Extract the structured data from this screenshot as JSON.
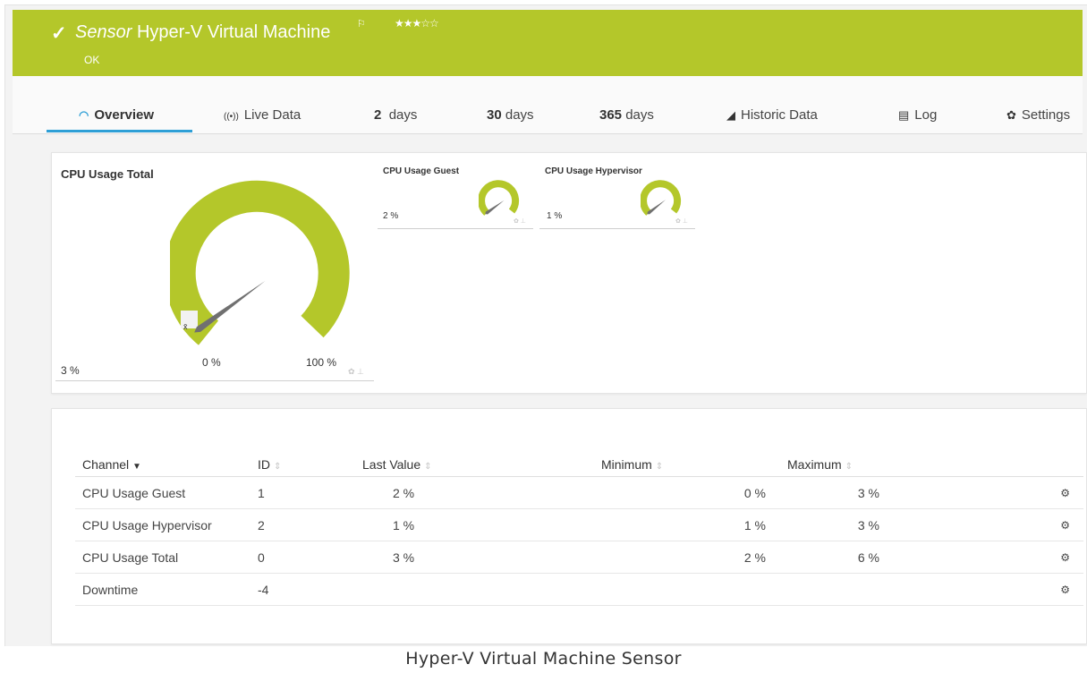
{
  "header": {
    "check_icon": "check-icon",
    "title_prefix": "Sensor",
    "title": "Hyper-V Virtual Machine",
    "flag_icon": "flag-icon",
    "stars": "★★★☆☆",
    "priority": 3,
    "status": "OK",
    "color": "#b4c72a"
  },
  "tabs": [
    {
      "label": "Overview",
      "icon": "gauge-icon",
      "active": true
    },
    {
      "label": "Live Data",
      "icon": "broadcast-icon"
    },
    {
      "num": "2",
      "label": "days"
    },
    {
      "num": "30",
      "label": "days"
    },
    {
      "num": "365",
      "label": "days"
    },
    {
      "label": "Historic Data",
      "icon": "area-chart-icon"
    },
    {
      "label": "Log",
      "icon": "list-icon"
    },
    {
      "label": "Settings",
      "icon": "gear-icon"
    }
  ],
  "gauges": {
    "total": {
      "title": "CPU Usage Total",
      "value": "3 %",
      "min": "0 %",
      "max": "100 %",
      "avg_symbol": "x̄",
      "percent": 3
    },
    "guest": {
      "title": "CPU Usage Guest",
      "value": "2 %",
      "percent": 2
    },
    "hypervisor": {
      "title": "CPU Usage Hypervisor",
      "value": "1 %",
      "percent": 1
    }
  },
  "table": {
    "headers": {
      "channel": "Channel",
      "id": "ID",
      "last": "Last Value",
      "min": "Minimum",
      "max": "Maximum"
    },
    "rows": [
      {
        "channel": "CPU Usage Guest",
        "id": "1",
        "last": "2 %",
        "min": "0 %",
        "max": "3 %"
      },
      {
        "channel": "CPU Usage Hypervisor",
        "id": "2",
        "last": "1 %",
        "min": "1 %",
        "max": "3 %"
      },
      {
        "channel": "CPU Usage Total",
        "id": "0",
        "last": "3 %",
        "min": "2 %",
        "max": "6 %"
      },
      {
        "channel": "Downtime",
        "id": "-4",
        "last": "",
        "min": "",
        "max": ""
      }
    ]
  },
  "caption": "Hyper-V Virtual Machine Sensor",
  "accent": "#2e9fd6"
}
